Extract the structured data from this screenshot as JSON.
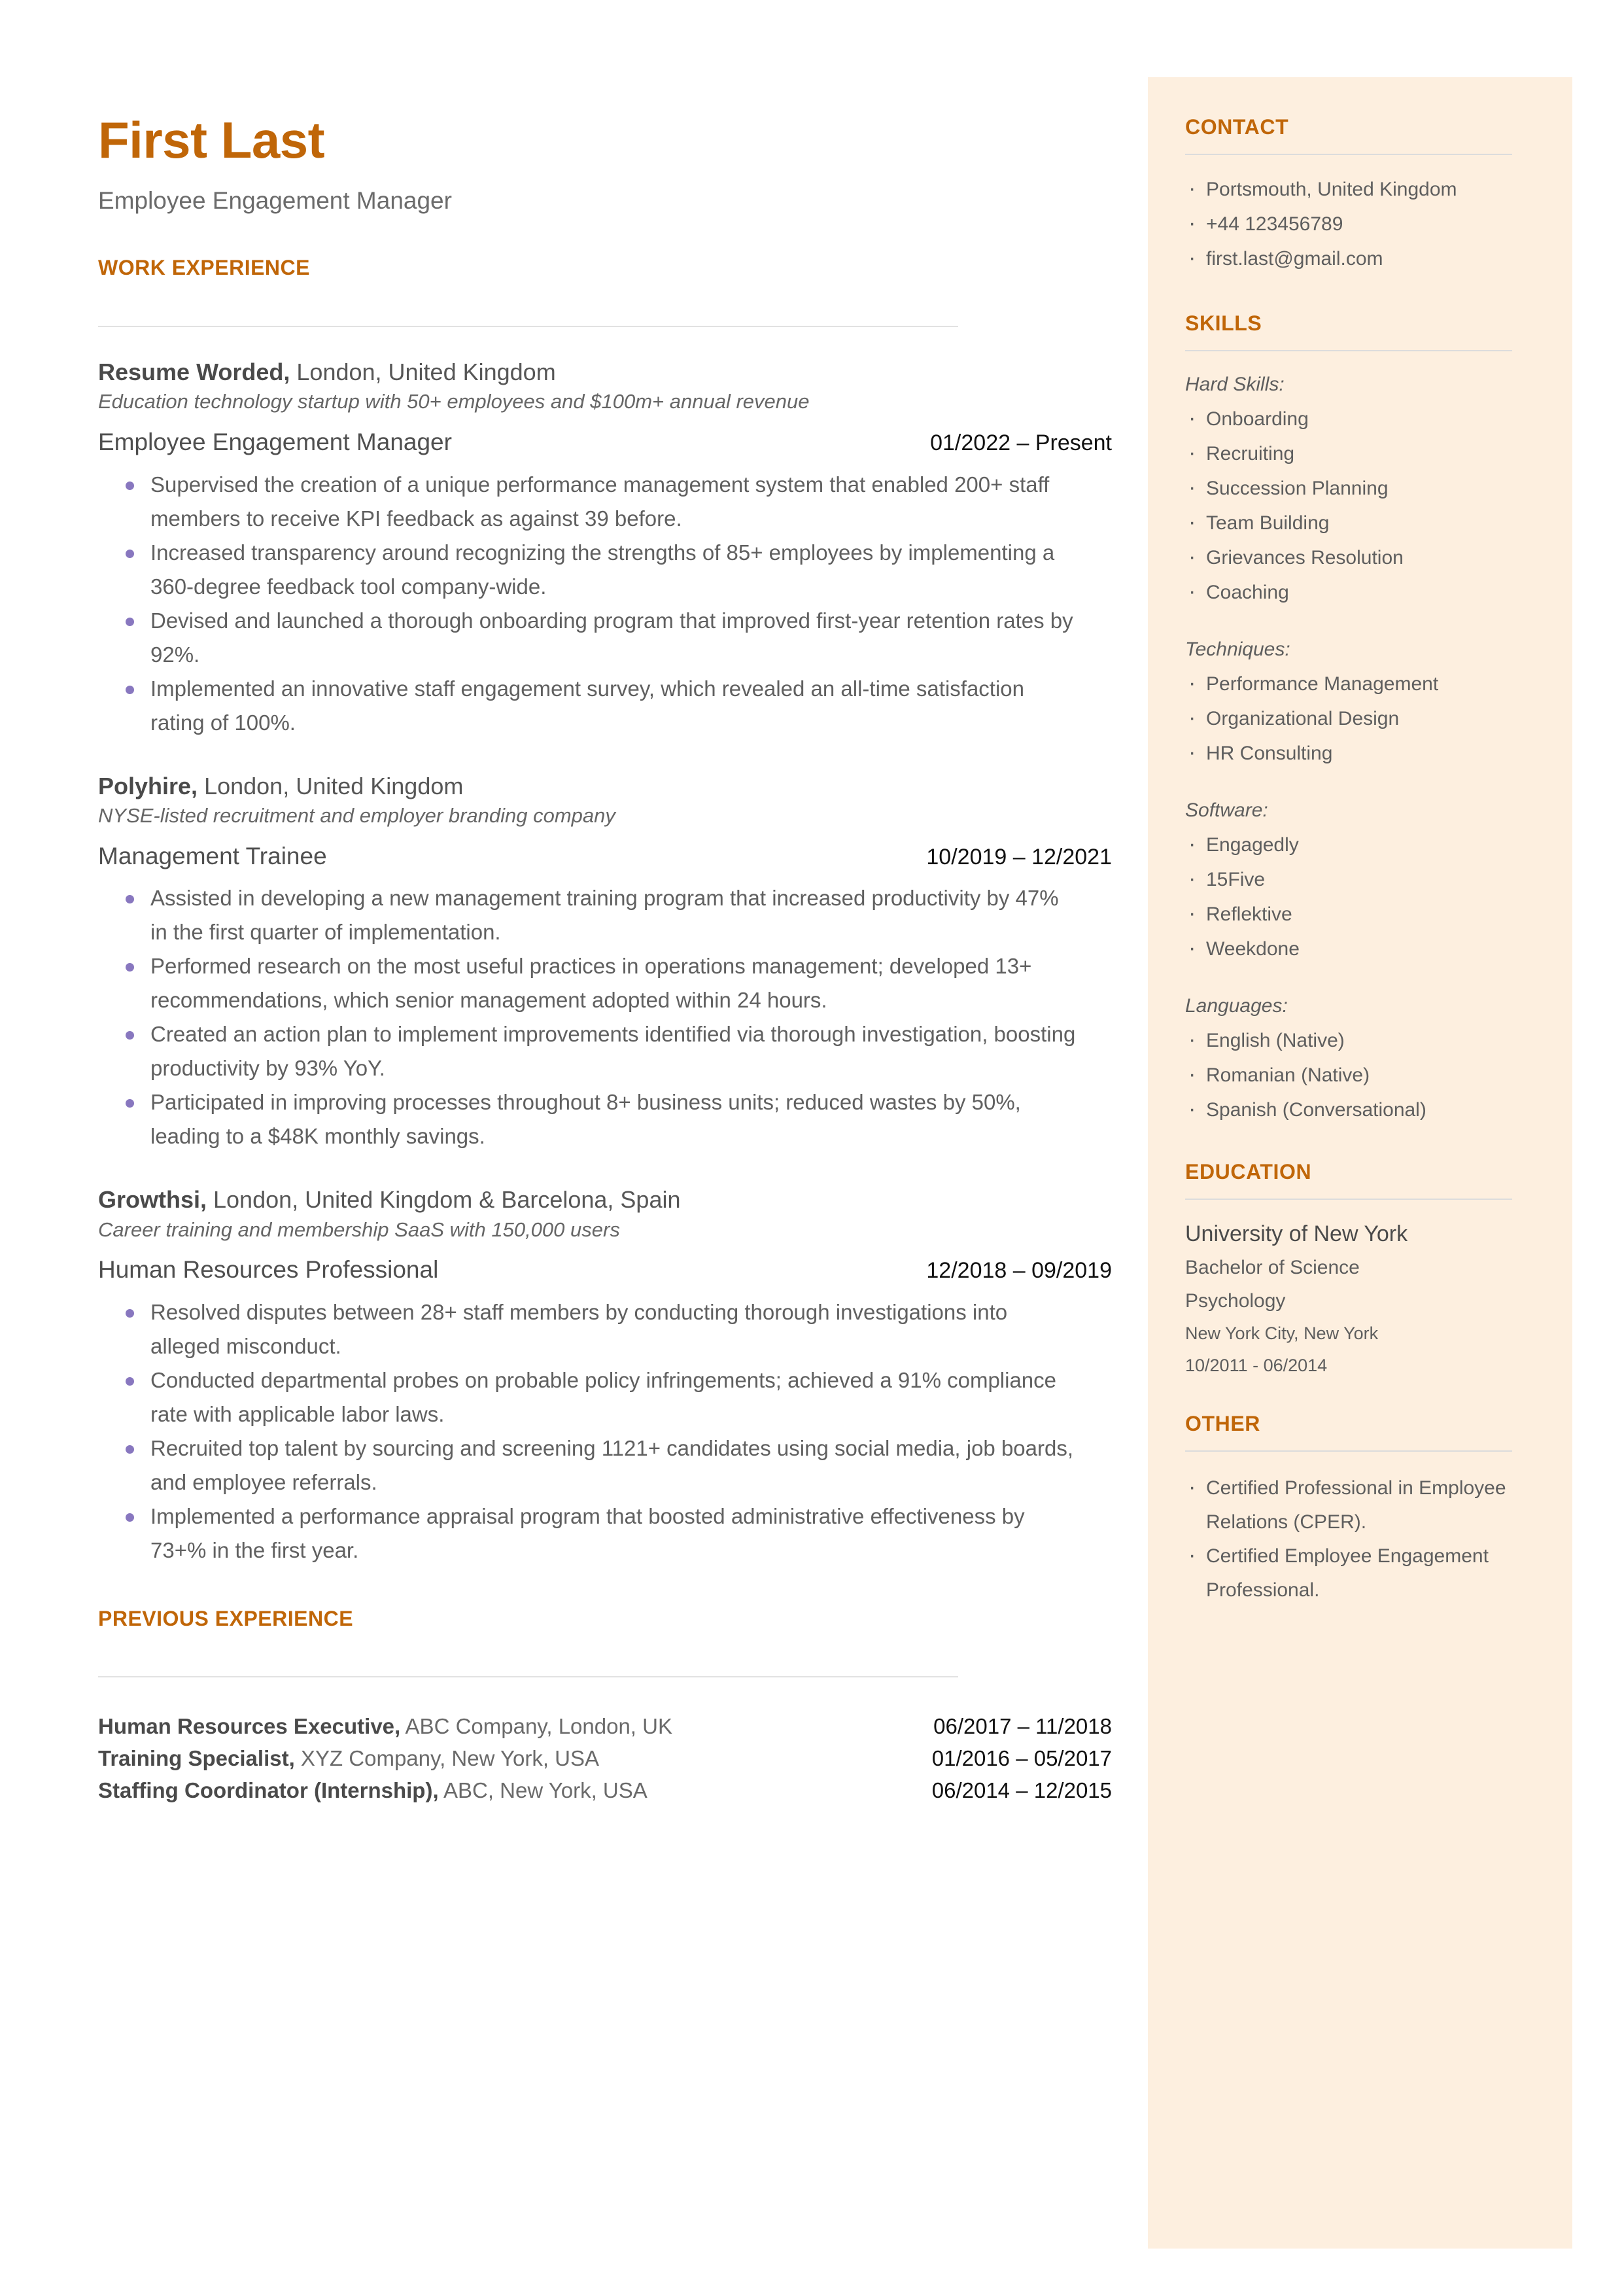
{
  "colors": {
    "accent": "#c06608",
    "sidebar_bg": "#fdefdf",
    "bullet": "#8877bf",
    "body_text": "#606060"
  },
  "header": {
    "name": "First Last",
    "subtitle": "Employee Engagement Manager"
  },
  "sections": {
    "work_experience": "WORK EXPERIENCE",
    "previous_experience": "PREVIOUS EXPERIENCE",
    "contact": "CONTACT",
    "skills": "SKILLS",
    "education": "EDUCATION",
    "other": "OTHER"
  },
  "jobs": [
    {
      "company": "Resume Worded,",
      "location": " London, United Kingdom",
      "description": "Education technology startup with 50+ employees and $100m+ annual revenue",
      "title": "Employee Engagement Manager",
      "dates": "01/2022 – Present",
      "bullets": [
        "Supervised the creation of a unique performance management system that enabled 200+ staff members to receive KPI feedback as against 39 before.",
        "Increased transparency around recognizing the strengths of 85+ employees by implementing a 360-degree feedback tool company-wide.",
        "Devised and launched a thorough onboarding program that improved first-year retention rates by 92%.",
        "Implemented an innovative staff engagement survey, which revealed an all-time satisfaction rating of 100%."
      ]
    },
    {
      "company": "Polyhire,",
      "location": " London, United Kingdom",
      "description": "NYSE-listed recruitment and employer branding company",
      "title": "Management Trainee",
      "dates": "10/2019 – 12/2021",
      "bullets": [
        "Assisted in developing a new management training program that increased productivity by 47% in the first quarter of implementation.",
        "Performed research on the most useful practices in operations management; developed 13+ recommendations, which senior management adopted within 24 hours.",
        "Created an action plan to implement improvements identified via thorough investigation, boosting productivity by 93% YoY.",
        "Participated in improving processes throughout 8+ business units; reduced wastes by 50%, leading to a $48K monthly savings."
      ]
    },
    {
      "company": "Growthsi,",
      "location": " London, United Kingdom & Barcelona, Spain",
      "description": "Career training and membership SaaS with 150,000 users",
      "title": "Human Resources Professional",
      "dates": "12/2018 – 09/2019",
      "bullets": [
        "Resolved disputes between 28+ staff members by conducting thorough investigations into alleged misconduct.",
        "Conducted departmental probes on probable policy infringements; achieved a 91% compliance rate with applicable labor laws.",
        "Recruited top talent by sourcing and screening 1121+ candidates using social media, job boards, and employee referrals.",
        "Implemented a performance appraisal program that boosted administrative effectiveness by 73+% in the first year."
      ]
    }
  ],
  "previous_experience": [
    {
      "title": "Human Resources Executive,",
      "detail": " ABC Company, London, UK",
      "dates": "06/2017 – 11/2018"
    },
    {
      "title": "Training Specialist,",
      "detail": " XYZ Company, New York, USA",
      "dates": "01/2016 – 05/2017"
    },
    {
      "title": "Staffing Coordinator (Internship),",
      "detail": " ABC, New York, USA",
      "dates": "06/2014 – 12/2015"
    }
  ],
  "contact": {
    "items": [
      "Portsmouth, United Kingdom",
      "+44 123456789",
      "first.last@gmail.com"
    ]
  },
  "skills": {
    "groups": [
      {
        "label": "Hard Skills:",
        "items": [
          "Onboarding",
          "Recruiting",
          "Succession Planning",
          "Team Building",
          "Grievances Resolution",
          "Coaching"
        ]
      },
      {
        "label": "Techniques:",
        "items": [
          "Performance Management",
          "Organizational Design",
          "HR Consulting"
        ]
      },
      {
        "label": "Software:",
        "items": [
          "Engagedly",
          "15Five",
          "Reflektive",
          "Weekdone"
        ]
      },
      {
        "label": "Languages:",
        "items": [
          "English (Native)",
          "Romanian (Native)",
          "Spanish (Conversational)"
        ]
      }
    ]
  },
  "education": {
    "school": "University of New York",
    "degree": "Bachelor of Science",
    "field": "Psychology",
    "location": "New York City, New York",
    "dates": "10/2011 - 06/2014"
  },
  "other": {
    "items": [
      "Certified Professional in Employee Relations (CPER).",
      "Certified Employee Engagement Professional."
    ]
  }
}
